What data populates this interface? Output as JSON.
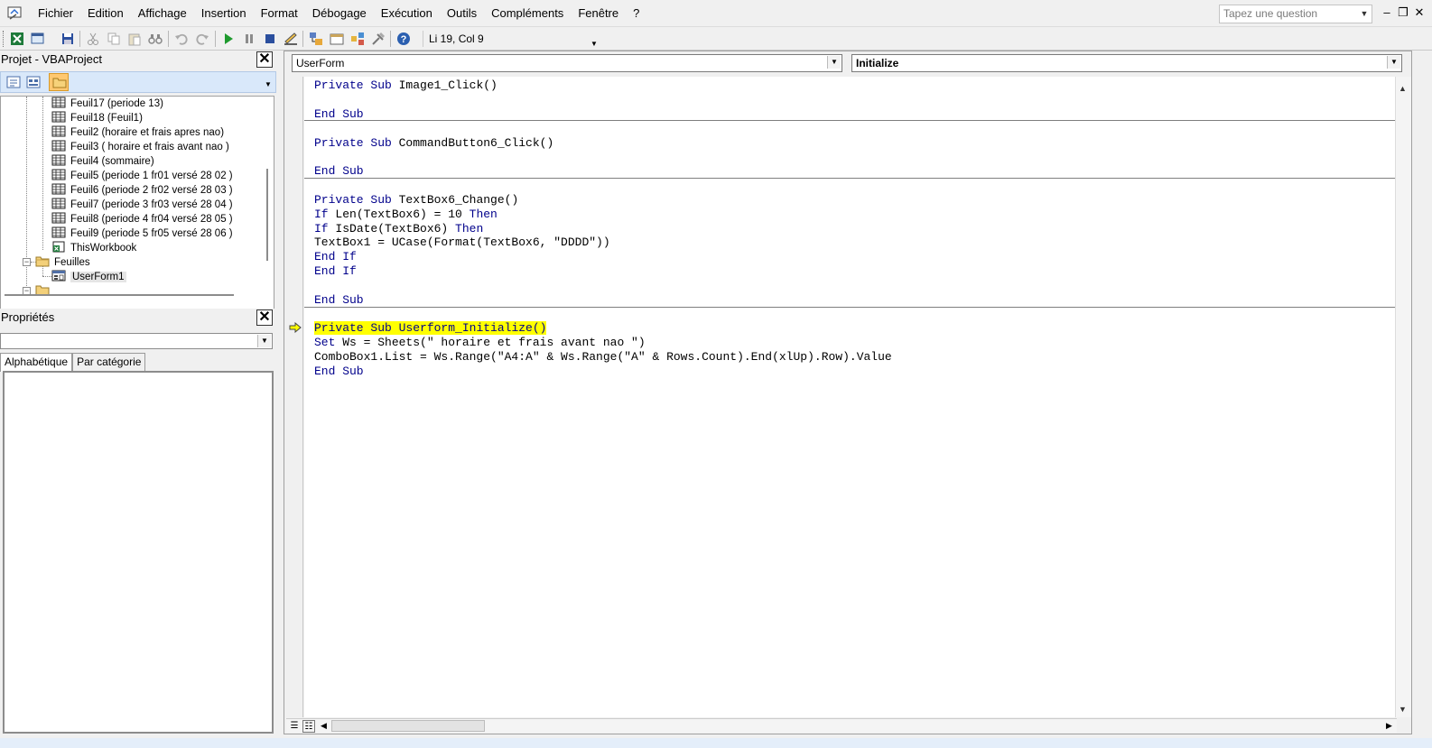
{
  "menu": {
    "items": [
      {
        "label": "Fichier"
      },
      {
        "label": "Edition"
      },
      {
        "label": "Affichage"
      },
      {
        "label": "Insertion"
      },
      {
        "label": "Format"
      },
      {
        "label": "Débogage"
      },
      {
        "label": "Exécution"
      },
      {
        "label": "Outils"
      },
      {
        "label": "Compléments"
      },
      {
        "label": "Fenêtre"
      },
      {
        "label": "?"
      }
    ],
    "ask_placeholder": "Tapez une question"
  },
  "toolbar": {
    "position": "Li 19, Col 9"
  },
  "project": {
    "title": "Projet - VBAProject",
    "items": [
      {
        "label": "Feuil17 (periode 13)"
      },
      {
        "label": "Feuil18 (Feuil1)"
      },
      {
        "label": "Feuil2 (horaire et frais apres nao)"
      },
      {
        "label": "Feuil3 ( horaire et frais avant nao )"
      },
      {
        "label": "Feuil4 (sommaire)"
      },
      {
        "label": "Feuil5 (periode 1  fr01 versé 28  02 )"
      },
      {
        "label": "Feuil6 (periode 2  fr02 versé 28  03 )"
      },
      {
        "label": "Feuil7 (periode 3  fr03 versé 28  04 )"
      },
      {
        "label": "Feuil8 (periode 4 fr04 versé 28  05 )"
      },
      {
        "label": "Feuil9 (periode 5  fr05 versé 28  06 )"
      },
      {
        "label": "ThisWorkbook"
      }
    ],
    "folder_label": "Feuilles",
    "form_label": "UserForm1"
  },
  "properties": {
    "title": "Propriétés",
    "tab_alpha": "Alphabétique",
    "tab_category": "Par catégorie"
  },
  "code": {
    "object_combo": "UserForm",
    "proc_combo": "Initialize",
    "lines": [
      {
        "kw": "Private Sub",
        "rest": " Image1_Click()"
      },
      {
        "kw": "",
        "rest": ""
      },
      {
        "kw": "End Sub",
        "rest": ""
      },
      {
        "kw": "Private Sub",
        "rest": " CommandButton6_Click()"
      },
      {
        "kw": "",
        "rest": ""
      },
      {
        "kw": "End Sub",
        "rest": ""
      },
      {
        "kw": "Private Sub",
        "rest": " TextBox6_Change()"
      },
      {
        "kw": "If",
        "rest": " Len(TextBox6) = 10 ",
        "kw2": "Then"
      },
      {
        "kw": "If",
        "rest": " IsDate(TextBox6) ",
        "kw2": "Then"
      },
      {
        "kw": "",
        "rest": "TextBox1 = UCase(Format(TextBox6, \"DDDD\"))"
      },
      {
        "kw": "End If",
        "rest": ""
      },
      {
        "kw": "End If",
        "rest": ""
      },
      {
        "kw": "",
        "rest": ""
      },
      {
        "kw": "End Sub",
        "rest": ""
      },
      {
        "kw": "Private Sub",
        "rest": " Userform_Initialize()"
      },
      {
        "kw": "Set",
        "rest": " Ws = Sheets(\" horaire et frais avant nao \")"
      },
      {
        "kw": "",
        "rest": "ComboBox1.List = Ws.Range(\"A4:A\" & Ws.Range(\"A\" & Rows.Count).End(xlUp).Row).Value"
      },
      {
        "kw": "End Sub",
        "rest": ""
      }
    ]
  },
  "colors": {
    "keyword": "#00008b",
    "highlight": "#ffff00"
  }
}
